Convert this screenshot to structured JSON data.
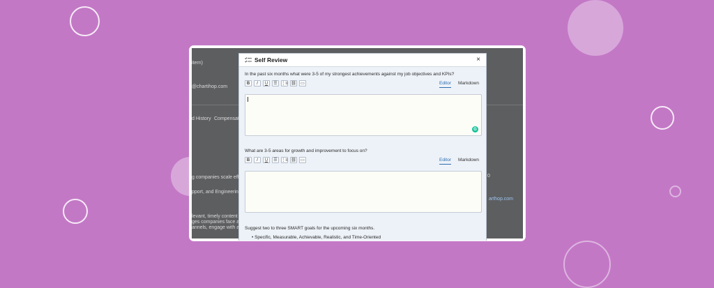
{
  "background_color": "#c378c6",
  "background_app": {
    "texts": [
      "itern)",
      "@chartihop.com",
      "d History",
      "Compensati",
      "g companies scale eff",
      "pport, and Engineering",
      "levant, timely content",
      "ges companies face ac",
      "annels, engage with ac"
    ],
    "right_texts": [
      "0",
      "arthop.com"
    ]
  },
  "modal": {
    "title": "Self Review",
    "close_label": "×",
    "questions": [
      {
        "text": "In the past six months what were 3-5 of my strongest achievements against my job objectives and KPIs?",
        "tabs": {
          "editor": "Editor",
          "markdown": "Markdown",
          "active": "editor"
        }
      },
      {
        "text": "What are 3-5 areas for growth and improvement to focus on?",
        "tabs": {
          "editor": "Editor",
          "markdown": "Markdown",
          "active": "editor"
        }
      }
    ],
    "toolbar_labels": {
      "bold": "B",
      "italic": "I",
      "underline": "U",
      "bullets": "☰",
      "numbered": "⋮≡",
      "link": "⛓",
      "image": "▭"
    },
    "grammarly_label": "G",
    "smart_prompt": "Suggest two to three SMART goals for the upcoming six months.",
    "smart_bullet": "Specific, Measurable, Achievable, Realistic, and Time-Oriented"
  }
}
